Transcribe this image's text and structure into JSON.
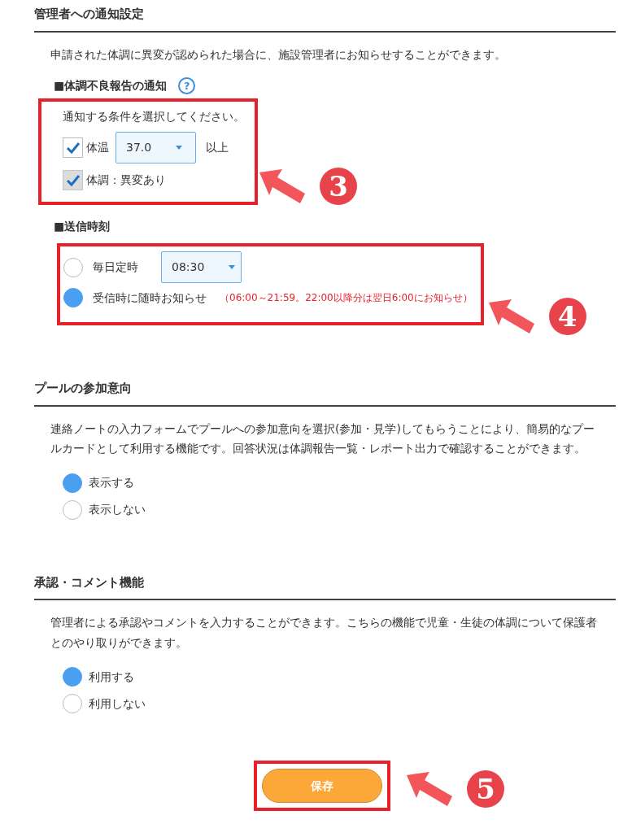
{
  "sections": [
    {
      "kind": "notify",
      "title": "管理者への通知設定",
      "description": "申請された体調に異変が認められた場合に、施設管理者にお知らせすることができます。",
      "condition": {
        "heading": "■体調不良報告の通知",
        "help": "?",
        "prompt": "通知する条件を選択してください。",
        "annotation": "3",
        "items": [
          {
            "kind": "select",
            "label": "体温",
            "checked": true,
            "disabled": false,
            "value": "37.0",
            "suffix": "以上"
          },
          {
            "kind": "plain",
            "label": "体調：異変あり",
            "checked": true,
            "disabled": true
          }
        ]
      },
      "timing": {
        "heading": "■送信時刻",
        "annotation": "4",
        "options": [
          {
            "kind": "select",
            "label": "毎日定時",
            "selected": false,
            "value": "08:30"
          },
          {
            "kind": "note",
            "label": "受信時に随時お知らせ",
            "selected": true,
            "note": "（06:00～21:59。22:00以降分は翌日6:00にお知らせ）"
          }
        ]
      }
    },
    {
      "kind": "radio",
      "title": "プールの参加意向",
      "description": "連絡ノートの入力フォームでプールへの参加意向を選択(参加・見学)してもらうことにより、簡易的なプールカードとして利用する機能です。回答状況は体調報告一覧・レポート出力で確認することができます。",
      "options": [
        {
          "label": "表示する",
          "selected": true
        },
        {
          "label": "表示しない",
          "selected": false
        }
      ]
    },
    {
      "kind": "radio",
      "title": "承認・コメント機能",
      "description": "管理者による承認やコメントを入力することができます。こちらの機能で児童・生徒の体調について保護者とのやり取りができます。",
      "options": [
        {
          "label": "利用する",
          "selected": true
        },
        {
          "label": "利用しない",
          "selected": false
        }
      ]
    }
  ],
  "save": {
    "label": "保存",
    "annotation": "5"
  }
}
